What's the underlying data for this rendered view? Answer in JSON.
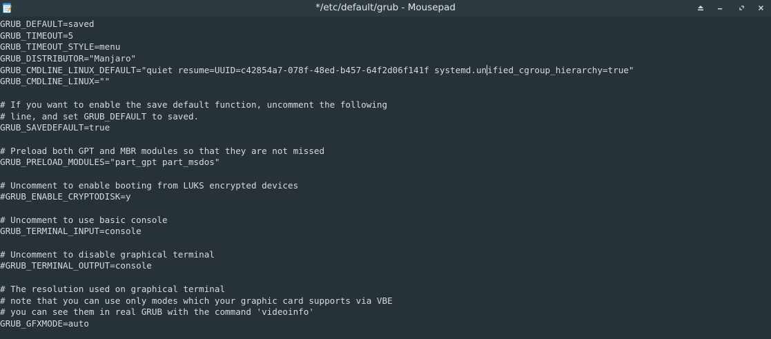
{
  "window": {
    "title": "*/etc/default/grub - Mousepad",
    "app_icon": "mousepad-notepad-icon",
    "buttons": [
      "shade-icon",
      "minimize-icon",
      "maximize-icon",
      "close-icon"
    ]
  },
  "editor": {
    "cursor_line": 5,
    "cursor_column": 94,
    "lines": [
      "GRUB_DEFAULT=saved",
      "GRUB_TIMEOUT=5",
      "GRUB_TIMEOUT_STYLE=menu",
      "GRUB_DISTRIBUTOR=\"Manjaro\"",
      "GRUB_CMDLINE_LINUX_DEFAULT=\"quiet resume=UUID=c42854a7-078f-48ed-b457-64f2d06f141f systemd.unified_cgroup_hierarchy=true\"",
      "GRUB_CMDLINE_LINUX=\"\"",
      "",
      "# If you want to enable the save default function, uncomment the following",
      "# line, and set GRUB_DEFAULT to saved.",
      "GRUB_SAVEDEFAULT=true",
      "",
      "# Preload both GPT and MBR modules so that they are not missed",
      "GRUB_PRELOAD_MODULES=\"part_gpt part_msdos\"",
      "",
      "# Uncomment to enable booting from LUKS encrypted devices",
      "#GRUB_ENABLE_CRYPTODISK=y",
      "",
      "# Uncomment to use basic console",
      "GRUB_TERMINAL_INPUT=console",
      "",
      "# Uncomment to disable graphical terminal",
      "#GRUB_TERMINAL_OUTPUT=console",
      "",
      "# The resolution used on graphical terminal",
      "# note that you can use only modes which your graphic card supports via VBE",
      "# you can see them in real GRUB with the command 'videoinfo'",
      "GRUB_GFXMODE=auto"
    ]
  }
}
